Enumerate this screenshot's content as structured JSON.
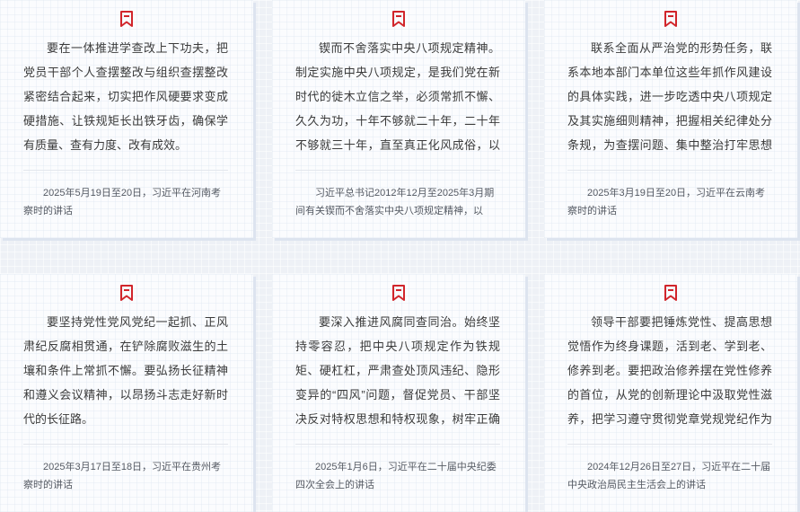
{
  "accent_color": "#d1252b",
  "cards": [
    {
      "icon": "bookmark-icon",
      "quote": "要在一体推进学查改上下功夫，把党员干部个人查摆整改与组织查摆整改紧密结合起来，切实把作风硬要求变成硬措施、让铁规矩长出铁牙齿，确保学有质量、查有力度、改有成效。",
      "source": "2025年5月19日至20日，习近平在河南考察时的讲话"
    },
    {
      "icon": "bookmark-icon",
      "quote": "锲而不舍落实中央八项规定精神。制定实施中央八项规定，是我们党在新时代的徙木立信之举，必须常抓不懈、久久为功，十年不够就二十年，二十年不够就三十年，直至真正化风成俗，以优良党风…",
      "source": "习近平总书记2012年12月至2025年3月期间有关锲而不舍落实中央八项规定精神，以优…"
    },
    {
      "icon": "bookmark-icon",
      "quote": "联系全面从严治党的形势任务，联系本地本部门本单位这些年抓作风建设的具体实践，进一步吃透中央八项规定及其实施细则精神，把握相关纪律处分条规，为查摆问题、集中整治打牢思想政治基础。",
      "source": "2025年3月19日至20日，习近平在云南考察时的讲话"
    },
    {
      "icon": "bookmark-icon",
      "quote": "要坚持党性党风党纪一起抓、正风肃纪反腐相贯通，在铲除腐败滋生的土壤和条件上常抓不懈。要弘扬长征精神和遵义会议精神，以昂扬斗志走好新时代的长征路。",
      "source": "2025年3月17日至18日，习近平在贵州考察时的讲话"
    },
    {
      "icon": "bookmark-icon",
      "quote": "要深入推进风腐同查同治。始终坚持零容忍，把中央八项规定作为铁规矩、硬杠杠，严肃查处顶风违纪、隐形变异的“四风”问题，督促党员、干部坚决反对特权思想和特权现象，树牢正确权力观…",
      "source": "2025年1月6日，习近平在二十届中央纪委四次全会上的讲话"
    },
    {
      "icon": "bookmark-icon",
      "quote": "领导干部要把锤炼党性、提高思想觉悟作为终身课题，活到老、学到老、修养到老。要把政治修养摆在党性修养的首位，从党的创新理论中汲取党性滋养，把学习遵守贯彻党章党规党纪作为党性修…",
      "source": "2024年12月26日至27日，习近平在二十届中央政治局民主生活会上的讲话"
    }
  ]
}
